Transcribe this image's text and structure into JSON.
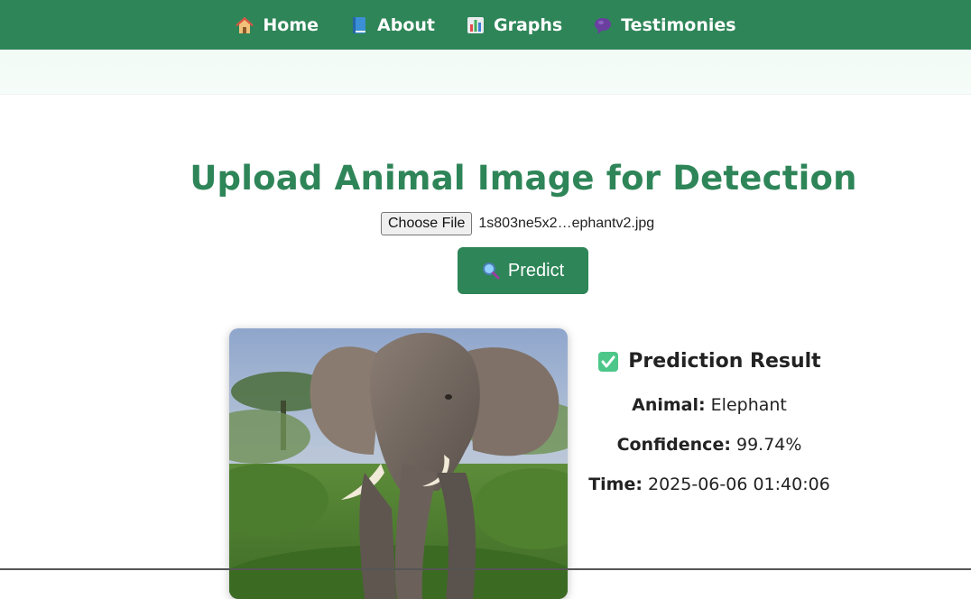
{
  "nav": {
    "items": [
      {
        "label": "Home",
        "icon": "house-icon"
      },
      {
        "label": "About",
        "icon": "book-icon"
      },
      {
        "label": "Graphs",
        "icon": "bar-chart-icon"
      },
      {
        "label": "Testimonies",
        "icon": "speech-bubble-icon"
      }
    ]
  },
  "main": {
    "title": "Upload Animal Image for Detection",
    "file_button": "Choose File",
    "file_name": "1s803ne5x2…ephantv2.jpg",
    "predict_label": "Predict",
    "predict_icon": "magnifier-icon"
  },
  "result": {
    "title": "Prediction Result",
    "icon": "check-box-icon",
    "animal_label": "Animal:",
    "animal_value": "Elephant",
    "confidence_label": "Confidence:",
    "confidence_value": "99.74%",
    "time_label": "Time:",
    "time_value": "2025-06-06 01:40:06"
  },
  "colors": {
    "brand_green": "#2e8558",
    "check_green": "#3cc47c"
  }
}
